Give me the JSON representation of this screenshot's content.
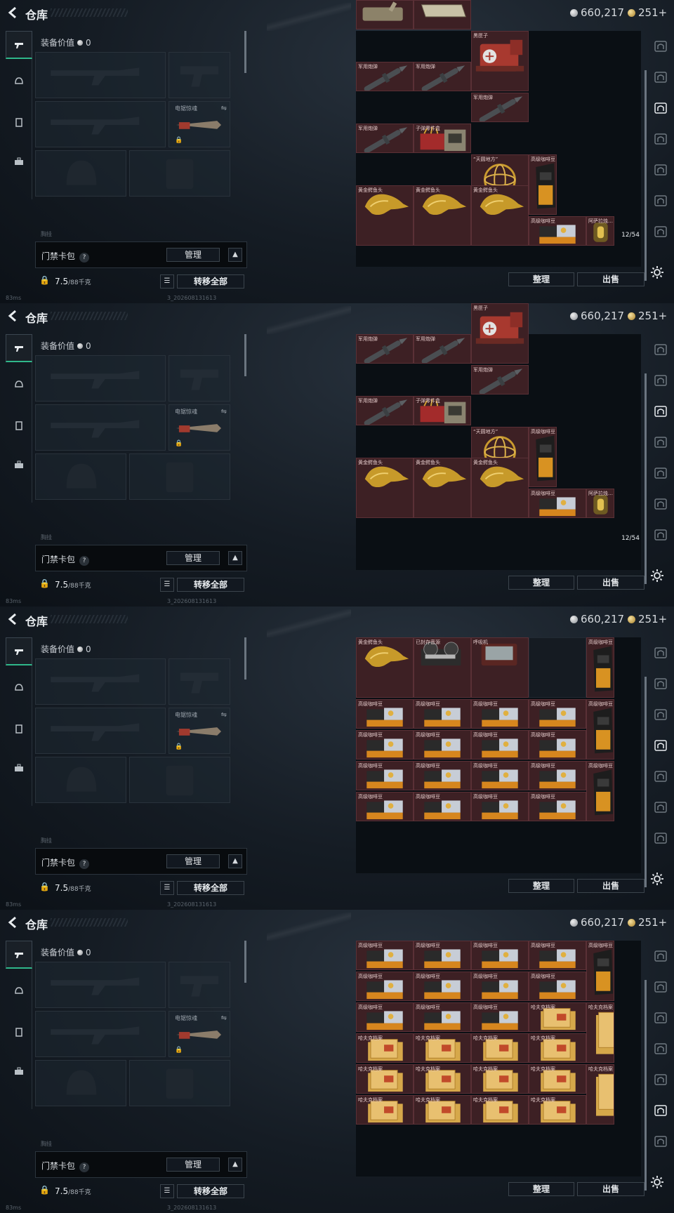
{
  "app": {
    "title": "仓库",
    "currency_silver": "660,217",
    "currency_gold": "251+"
  },
  "equipment": {
    "header_label": "装备价值",
    "header_value": "0",
    "slot_label": "电锯惊魂",
    "backpack_label": "门禁卡包",
    "manage": "管理",
    "weight_value": "7.5",
    "weight_unit": "/88千克",
    "transfer_all": "转移全部",
    "faded_text": "胸挂"
  },
  "status": {
    "ping": "83ms",
    "build": "3_202608131613"
  },
  "stash_actions": {
    "sort": "整理",
    "sell": "出售"
  },
  "frames": [
    {
      "cells": [
        {
          "label": "",
          "kind": "tank",
          "col": 0,
          "row": -1
        },
        {
          "label": "",
          "kind": "crate",
          "col": 1,
          "row": -1
        },
        {
          "label": "黑匣子",
          "kind": "blackbox",
          "col": 2,
          "row": 0
        },
        {
          "label": "军用炮弹",
          "kind": "shell",
          "col": 0,
          "row": 1
        },
        {
          "label": "军用炮弹",
          "kind": "shell",
          "col": 1,
          "row": 1
        },
        {
          "label": "军用炮弹",
          "kind": "shell",
          "col": 2,
          "row": 2
        },
        {
          "label": "军用炮弹",
          "kind": "shell",
          "col": 0,
          "row": 3
        },
        {
          "label": "子弹零件盒",
          "kind": "partsbox",
          "col": 1,
          "row": 3
        },
        {
          "label": "“天圆地方”",
          "kind": "globe",
          "col": 2,
          "row": 4
        },
        {
          "label": "高级咖啡豆",
          "kind": "coffeebag",
          "col": 3,
          "row": 4
        },
        {
          "label": "黄金鳄鱼头",
          "kind": "croc",
          "col": 0,
          "row": 5
        },
        {
          "label": "黄金鳄鱼头",
          "kind": "croc",
          "col": 1,
          "row": 5
        },
        {
          "label": "黄金鳄鱼头",
          "kind": "croc",
          "col": 2,
          "row": 5
        },
        {
          "label": "高级咖啡豆",
          "kind": "coffeebox",
          "col": 3,
          "row": 6
        },
        {
          "label": "阿萨拉烛…",
          "kind": "candle",
          "col": 4,
          "row": 6
        }
      ],
      "count": "12/54"
    },
    {
      "cells": [
        {
          "label": "军用炮弹",
          "kind": "shell",
          "col": 0,
          "row": 0
        },
        {
          "label": "军用炮弹",
          "kind": "shell",
          "col": 1,
          "row": 0
        },
        {
          "label": "黑匣子",
          "kind": "blackbox",
          "col": 2,
          "row": -1
        },
        {
          "label": "军用炮弹",
          "kind": "shell",
          "col": 2,
          "row": 1
        },
        {
          "label": "军用炮弹",
          "kind": "shell",
          "col": 0,
          "row": 2
        },
        {
          "label": "子弹零件盒",
          "kind": "partsbox",
          "col": 1,
          "row": 2
        },
        {
          "label": "“天圆地方”",
          "kind": "globe",
          "col": 2,
          "row": 3
        },
        {
          "label": "高级咖啡豆",
          "kind": "coffeebag",
          "col": 3,
          "row": 3
        },
        {
          "label": "黄金鳄鱼头",
          "kind": "croc",
          "col": 0,
          "row": 4
        },
        {
          "label": "黄金鳄鱼头",
          "kind": "croc",
          "col": 1,
          "row": 4
        },
        {
          "label": "黄金鳄鱼头",
          "kind": "croc",
          "col": 2,
          "row": 4
        },
        {
          "label": "高级咖啡豆",
          "kind": "coffeebox",
          "col": 3,
          "row": 5
        },
        {
          "label": "阿萨拉烛…",
          "kind": "candle",
          "col": 4,
          "row": 5
        }
      ],
      "count": "12/54"
    },
    {
      "cells": [
        {
          "label": "黄金鳄鱼头",
          "kind": "croc",
          "col": 0,
          "row": 0
        },
        {
          "label": "已封存音源",
          "kind": "reel",
          "col": 1,
          "row": 0
        },
        {
          "label": "呼吸机",
          "kind": "ventilator",
          "col": 2,
          "row": 0
        },
        {
          "label": "高级咖啡豆",
          "kind": "coffeebag",
          "col": 4,
          "row": 0
        },
        {
          "label": "高级咖啡豆",
          "kind": "coffeebox",
          "col": 0,
          "row": 2
        },
        {
          "label": "高级咖啡豆",
          "kind": "coffeebox",
          "col": 1,
          "row": 2
        },
        {
          "label": "高级咖啡豆",
          "kind": "coffeebox",
          "col": 2,
          "row": 2
        },
        {
          "label": "高级咖啡豆",
          "kind": "coffeebox",
          "col": 3,
          "row": 2
        },
        {
          "label": "高级咖啡豆",
          "kind": "coffeebag",
          "col": 4,
          "row": 2
        },
        {
          "label": "高级咖啡豆",
          "kind": "coffeebox",
          "col": 0,
          "row": 3
        },
        {
          "label": "高级咖啡豆",
          "kind": "coffeebox",
          "col": 1,
          "row": 3
        },
        {
          "label": "高级咖啡豆",
          "kind": "coffeebox",
          "col": 2,
          "row": 3
        },
        {
          "label": "高级咖啡豆",
          "kind": "coffeebox",
          "col": 3,
          "row": 3
        },
        {
          "label": "高级咖啡豆",
          "kind": "coffeebox",
          "col": 0,
          "row": 4
        },
        {
          "label": "高级咖啡豆",
          "kind": "coffeebox",
          "col": 1,
          "row": 4
        },
        {
          "label": "高级咖啡豆",
          "kind": "coffeebox",
          "col": 2,
          "row": 4
        },
        {
          "label": "高级咖啡豆",
          "kind": "coffeebox",
          "col": 3,
          "row": 4
        },
        {
          "label": "高级咖啡豆",
          "kind": "coffeebag",
          "col": 4,
          "row": 4
        },
        {
          "label": "高级咖啡豆",
          "kind": "coffeebox",
          "col": 0,
          "row": 5
        },
        {
          "label": "高级咖啡豆",
          "kind": "coffeebox",
          "col": 1,
          "row": 5
        },
        {
          "label": "高级咖啡豆",
          "kind": "coffeebox",
          "col": 2,
          "row": 5
        },
        {
          "label": "高级咖啡豆",
          "kind": "coffeebox",
          "col": 3,
          "row": 5
        }
      ],
      "empty": [
        {
          "col": 3,
          "row": 0
        }
      ],
      "count": ""
    },
    {
      "cells": [
        {
          "label": "高级咖啡豆",
          "kind": "coffeebox",
          "col": 0,
          "row": 0
        },
        {
          "label": "高级咖啡豆",
          "kind": "coffeebox",
          "col": 1,
          "row": 0
        },
        {
          "label": "高级咖啡豆",
          "kind": "coffeebox",
          "col": 2,
          "row": 0
        },
        {
          "label": "高级咖啡豆",
          "kind": "coffeebox",
          "col": 3,
          "row": 0
        },
        {
          "label": "高级咖啡豆",
          "kind": "coffeebag",
          "col": 4,
          "row": 0
        },
        {
          "label": "高级咖啡豆",
          "kind": "coffeebox",
          "col": 0,
          "row": 1
        },
        {
          "label": "高级咖啡豆",
          "kind": "coffeebox",
          "col": 1,
          "row": 1
        },
        {
          "label": "高级咖啡豆",
          "kind": "coffeebox",
          "col": 2,
          "row": 1
        },
        {
          "label": "高级咖啡豆",
          "kind": "coffeebox",
          "col": 3,
          "row": 1
        },
        {
          "label": "高级咖啡豆",
          "kind": "coffeebox",
          "col": 0,
          "row": 2
        },
        {
          "label": "高级咖啡豆",
          "kind": "coffeebox",
          "col": 1,
          "row": 2
        },
        {
          "label": "高级咖啡豆",
          "kind": "coffeebox",
          "col": 2,
          "row": 2
        },
        {
          "label": "哈夫克档案",
          "kind": "file",
          "col": 3,
          "row": 2
        },
        {
          "label": "哈夫克档案",
          "kind": "filetall",
          "col": 4,
          "row": 2
        },
        {
          "label": "哈夫克档案",
          "kind": "file",
          "col": 0,
          "row": 3
        },
        {
          "label": "哈夫克档案",
          "kind": "file",
          "col": 1,
          "row": 3
        },
        {
          "label": "哈夫克档案",
          "kind": "file",
          "col": 2,
          "row": 3
        },
        {
          "label": "哈夫克档案",
          "kind": "file",
          "col": 3,
          "row": 3
        },
        {
          "label": "哈夫克档案",
          "kind": "file",
          "col": 0,
          "row": 4
        },
        {
          "label": "哈夫克档案",
          "kind": "file",
          "col": 1,
          "row": 4
        },
        {
          "label": "哈夫克档案",
          "kind": "file",
          "col": 2,
          "row": 4
        },
        {
          "label": "哈夫克档案",
          "kind": "file",
          "col": 3,
          "row": 4
        },
        {
          "label": "哈夫克档案",
          "kind": "filetall",
          "col": 4,
          "row": 4
        },
        {
          "label": "哈夫克档案",
          "kind": "file",
          "col": 0,
          "row": 5
        },
        {
          "label": "哈夫克档案",
          "kind": "file",
          "col": 1,
          "row": 5
        },
        {
          "label": "哈夫克档案",
          "kind": "file",
          "col": 2,
          "row": 5
        },
        {
          "label": "哈夫克档案",
          "kind": "file",
          "col": 3,
          "row": 5
        }
      ],
      "count": ""
    }
  ],
  "icons": {
    "back": "chevron-left-icon",
    "nav": [
      "gun-icon",
      "helmet-icon",
      "vest-icon",
      "toolbox-icon"
    ],
    "right_tabs": [
      "arch-icon",
      "tab-tv-icon",
      "tab-rad-icon",
      "tab-tv-icon",
      "tab-tv-icon",
      "tab-tv-icon",
      "tab-img-icon"
    ],
    "settings": "gear-icon"
  },
  "colors": {
    "accent_green": "#2fb78a",
    "cell_red": "#3d2024"
  }
}
